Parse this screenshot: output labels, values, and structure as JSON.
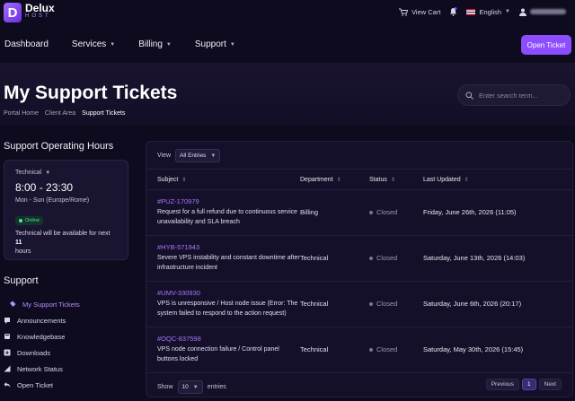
{
  "brand": {
    "name": "Delux",
    "sub": "HOST",
    "mark": "D"
  },
  "topbar": {
    "view_cart": "View Cart",
    "language": "English"
  },
  "nav": {
    "items": [
      {
        "label": "Dashboard"
      },
      {
        "label": "Services"
      },
      {
        "label": "Billing"
      },
      {
        "label": "Support"
      }
    ],
    "open_ticket": "Open Ticket"
  },
  "hero": {
    "title": "My Support Tickets",
    "breadcrumb": [
      "Portal Home",
      "Client Area",
      "Support Tickets"
    ],
    "search_placeholder": "Enter search term..."
  },
  "hours": {
    "heading": "Support Operating Hours",
    "department": "Technical",
    "time": "8:00 - 23:30",
    "days": "Mon - Sun (Europe/Rome)",
    "status": "Online",
    "avail_prefix": "Technical will be available for next ",
    "avail_value": "11",
    "avail_suffix": "hours"
  },
  "support_menu": {
    "heading": "Support",
    "items": [
      {
        "label": "My Support Tickets",
        "icon": "ticket-icon"
      },
      {
        "label": "Announcements",
        "icon": "megaphone-icon"
      },
      {
        "label": "Knowledgebase",
        "icon": "book-icon"
      },
      {
        "label": "Downloads",
        "icon": "download-icon"
      },
      {
        "label": "Network Status",
        "icon": "signal-icon"
      },
      {
        "label": "Open Ticket",
        "icon": "reply-icon"
      }
    ]
  },
  "tickets": {
    "view_label": "View",
    "view_value": "All Entries",
    "columns": [
      "Subject",
      "Department",
      "Status",
      "Last Updated"
    ],
    "rows": [
      {
        "id": "#PUZ-170979",
        "subject": "Request for a full refund due to continuous service unavailability and SLA breach",
        "department": "Billing",
        "status": "Closed",
        "updated": "Friday, June 26th, 2026 (11:05)"
      },
      {
        "id": "#HYB-571943",
        "subject": "Severe VPS instability and constant downtime after infrastructure incident",
        "department": "Technical",
        "status": "Closed",
        "updated": "Saturday, June 13th, 2026 (14:03)"
      },
      {
        "id": "#UMV-330930",
        "subject": "VPS is unresponsive / Host node issue (Error: The system failed to respond to the action request)",
        "department": "Technical",
        "status": "Closed",
        "updated": "Saturday, June 6th, 2026 (20:17)"
      },
      {
        "id": "#OQC-837598",
        "subject": "VPS node connection failure / Control panel buttons locked",
        "department": "Technical",
        "status": "Closed",
        "updated": "Saturday, May 30th, 2026 (15:45)"
      }
    ],
    "show_label": "Show",
    "show_value": "10",
    "entries_label": "entries",
    "prev": "Previous",
    "page": "1",
    "next": "Next"
  },
  "colors": {
    "accent": "#8b4dff",
    "link": "#a875ff",
    "online": "#4be39a",
    "bg": "#0f0b1f"
  }
}
